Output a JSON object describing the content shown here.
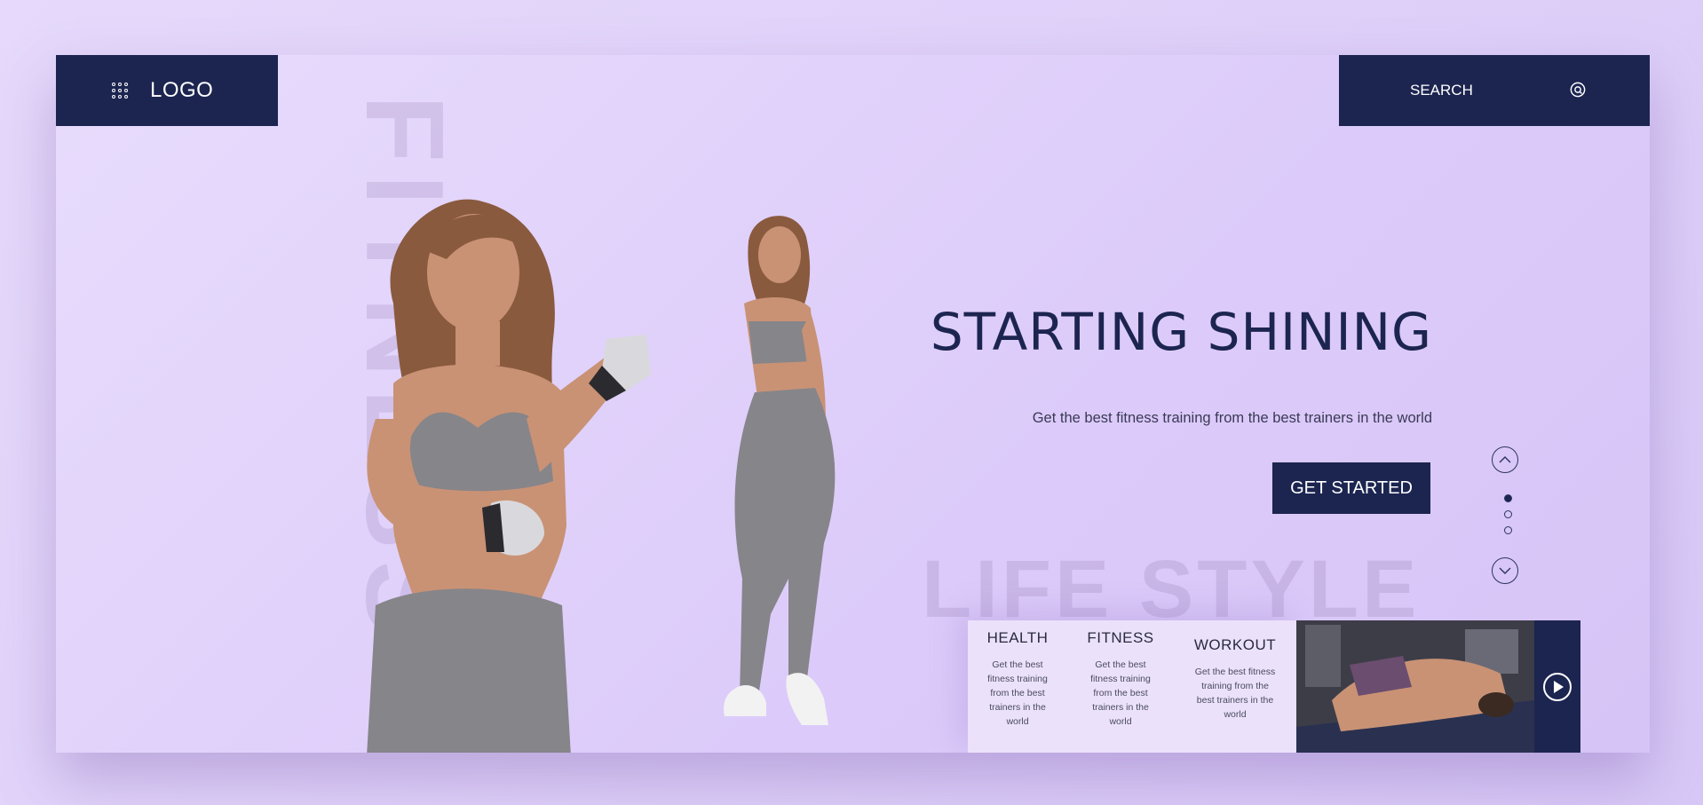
{
  "header": {
    "logo_text": "LOGO",
    "search_label": "SEARCH"
  },
  "background_words": {
    "vertical": "FITNESS",
    "horizontal": "LIFE STYLE"
  },
  "hero": {
    "title": "STARTING SHINING",
    "subtitle": "Get the best fitness training from the best trainers in the world",
    "cta_label": "GET STARTED"
  },
  "slider": {
    "up_icon": "chevron-up-icon",
    "down_icon": "chevron-down-icon",
    "dots_total": 3,
    "active_dot": 1
  },
  "categories": [
    {
      "title": "HEALTH",
      "text": "Get the best fitness training from the best trainers in the world"
    },
    {
      "title": "FITNESS",
      "text": "Get the best fitness training from the best trainers in the world"
    },
    {
      "title": "WORKOUT",
      "text": "Get the best fitness training from the best trainers in the world"
    }
  ],
  "colors": {
    "navy": "#1c2550",
    "background": "#e2d4fa"
  },
  "icons": {
    "menu": "grid-icon",
    "search": "search-icon",
    "play": "play-icon"
  }
}
